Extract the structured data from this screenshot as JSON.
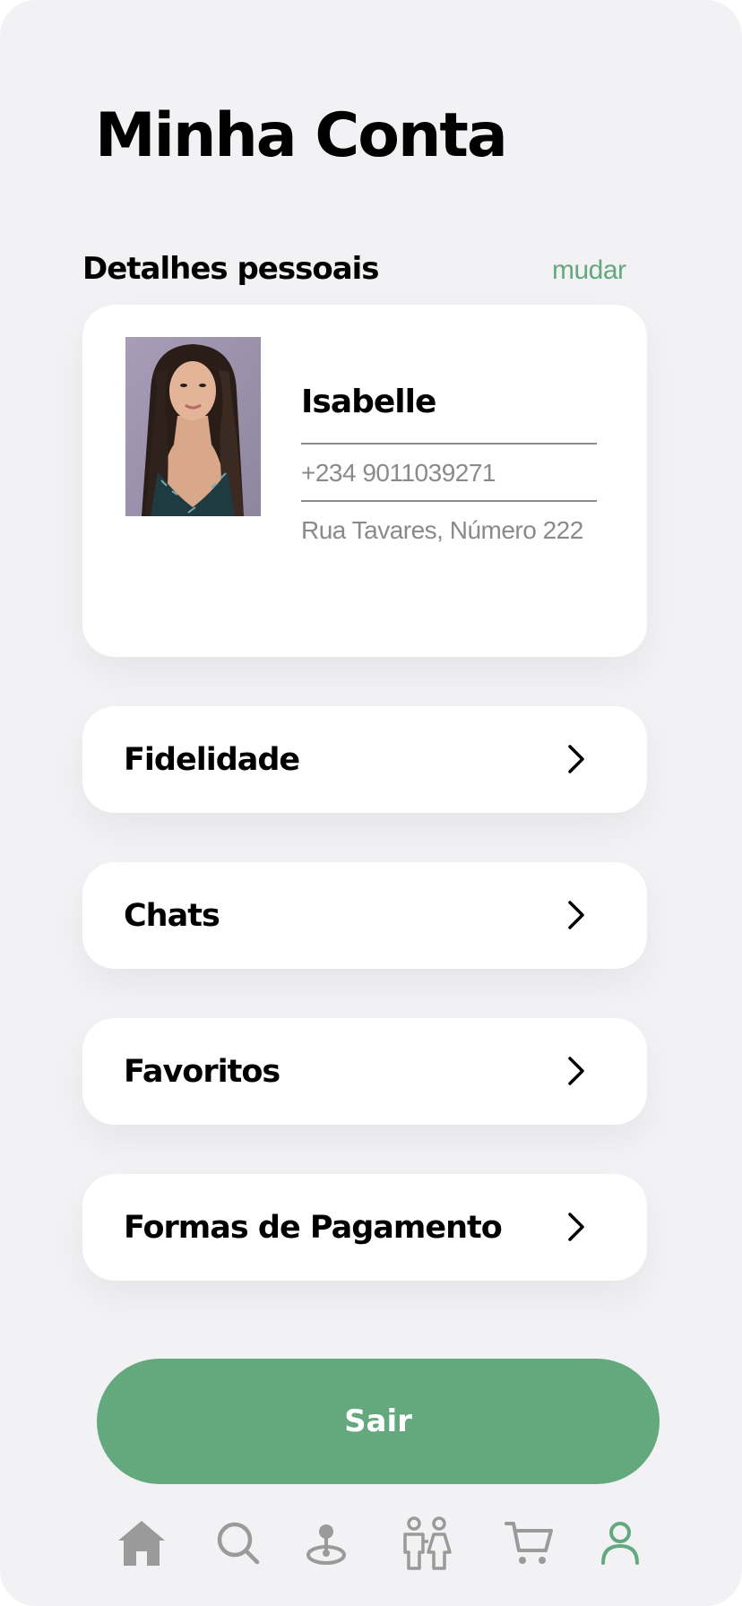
{
  "header": {
    "title": "Minha Conta"
  },
  "personal_details": {
    "section_title": "Detalhes pessoais",
    "change_label": "mudar",
    "name": "Isabelle",
    "phone": "+234 9011039271",
    "address": "Rua Tavares, Número 222"
  },
  "menu": {
    "items": [
      {
        "label": "Fidelidade"
      },
      {
        "label": "Chats"
      },
      {
        "label": "Favoritos"
      },
      {
        "label": "Formas de Pagamento"
      }
    ]
  },
  "logout": {
    "label": "Sair"
  },
  "tabbar": {
    "tabs": [
      {
        "icon": "home-icon"
      },
      {
        "icon": "search-icon"
      },
      {
        "icon": "location-pin-icon"
      },
      {
        "icon": "couple-icon"
      },
      {
        "icon": "cart-icon"
      },
      {
        "icon": "user-icon",
        "active": true
      }
    ]
  },
  "colors": {
    "accent": "#63a97d",
    "background": "#f2f2f4",
    "muted_text": "#8a8a8a",
    "inactive_icon": "#9a9a9a"
  }
}
